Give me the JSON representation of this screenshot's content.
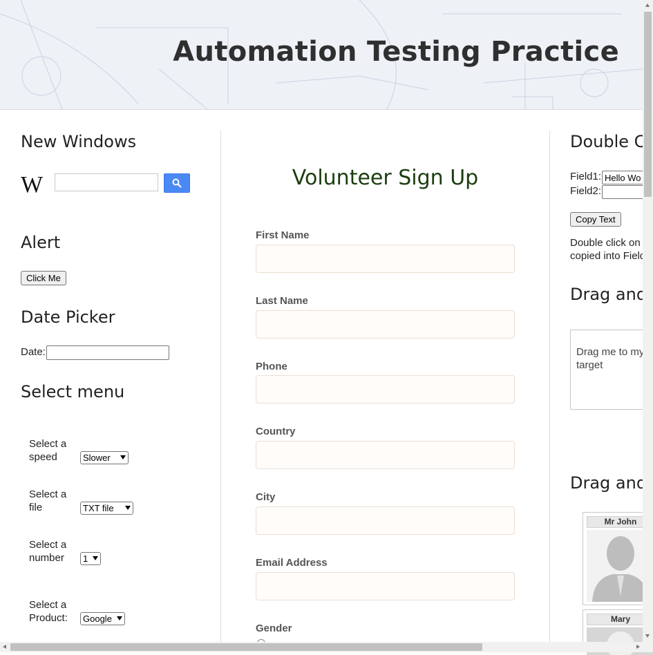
{
  "header": {
    "title": "Automation Testing Practice"
  },
  "left": {
    "new_windows": {
      "heading": "New Windows",
      "search_value": ""
    },
    "alert": {
      "heading": "Alert",
      "button_label": "Click Me"
    },
    "date_picker": {
      "heading": "Date Picker",
      "label": "Date:",
      "value": ""
    },
    "select_menu": {
      "heading": "Select menu",
      "speed": {
        "label_line1": "Select a",
        "label_line2": "speed",
        "selected": "Slower"
      },
      "file": {
        "label_line1": "Select a",
        "label_line2": "file",
        "selected": "TXT file"
      },
      "number": {
        "label_line1": "Select a",
        "label_line2": "number",
        "selected": "1"
      },
      "product": {
        "label_line1": "Select a",
        "label_line2": "Product:",
        "selected": "Google"
      }
    }
  },
  "center": {
    "title": "Volunteer Sign Up",
    "fields": [
      {
        "label": "First Name",
        "value": ""
      },
      {
        "label": "Last Name",
        "value": ""
      },
      {
        "label": "Phone",
        "value": ""
      },
      {
        "label": "Country",
        "value": ""
      },
      {
        "label": "City",
        "value": ""
      },
      {
        "label": "Email Address",
        "value": ""
      }
    ],
    "gender_label": "Gender"
  },
  "right": {
    "double_click": {
      "heading": "Double Cl",
      "field1_label": "Field1:",
      "field1_value": "Hello Wo",
      "field2_label": "Field2:",
      "field2_value": "",
      "copy_button": "Copy Text",
      "desc_line1": "Double click on b",
      "desc_line2": "copied into Field"
    },
    "drag_drop": {
      "heading": "Drag and",
      "box_line1": "Drag me to my",
      "box_line2": "target"
    },
    "drag_gallery": {
      "heading": "Drag and",
      "cards": [
        {
          "name": "Mr John"
        },
        {
          "name": "Mary"
        }
      ]
    }
  },
  "colors": {
    "accent_blue": "#4a89f3",
    "title_green": "#1b3d0f",
    "input_bg": "#fffcf9"
  }
}
